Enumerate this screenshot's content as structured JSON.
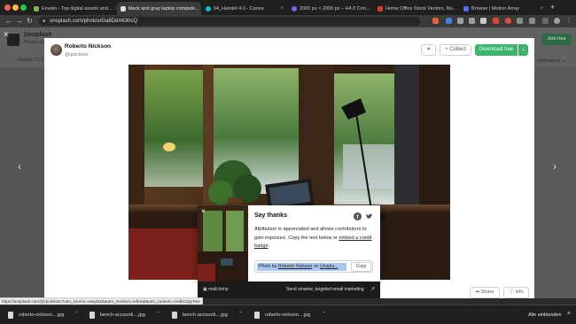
{
  "browser": {
    "tabs": [
      {
        "title": "Envato - Top digital assets and...",
        "active": false,
        "icon_color": "#82b541"
      },
      {
        "title": "black and gray laptop compute...",
        "active": true,
        "icon_color": "#dddddd"
      },
      {
        "title": "04_Handel 4.0 - Canva",
        "active": false,
        "icon_color": "#00c4cc"
      },
      {
        "title": "2000 px × 2000 px – H4.0 Con...",
        "active": false,
        "icon_color": "#7b61ff"
      },
      {
        "title": "Home Office Stock Vectors, Illu...",
        "active": false,
        "icon_color": "#e03a2f"
      },
      {
        "title": "Browse | Motion Array",
        "active": false,
        "icon_color": "#4a6cf7"
      }
    ],
    "tab_close_icon": "×",
    "new_tab_icon": "+",
    "back_icon": "←",
    "forward_icon": "→",
    "reload_icon": "↻",
    "url": "unsplash.com/photos/Ga8DdA630cQ"
  },
  "background": {
    "site_title": "Unsplash",
    "site_sub": "Photos fo",
    "photos_tab": "Photos 72.5",
    "relevance": "Relevance ⌄",
    "join_button": "Join free"
  },
  "modal": {
    "close_icon": "×",
    "prev_icon": "‹",
    "next_icon": "›",
    "author_name": "Roberto Nickson",
    "author_handle": "@rpnickson",
    "like_icon": "♥",
    "collect_label": "+ Collect",
    "download_label": "Download free",
    "download_menu_icon": "⌄",
    "share_label": "➦ Share",
    "info_label": "ⓘ Info"
  },
  "say_thanks": {
    "close_icon": "×",
    "title": "Say thanks",
    "body": "Attribution is appreciated and allows contributors to gain exposure. Copy the text below or",
    "link": "embed a credit badge",
    "link_end": ".",
    "credit_prefix": "Photo by ",
    "credit_author": "Roberto Nickson",
    "credit_mid": " on ",
    "credit_site": "Unspla...",
    "copy_label": "Copy"
  },
  "ad": {
    "logo": "▣ mailchimp",
    "text": "Send smarter, targeted email marketing",
    "icon": "↗"
  },
  "status_url": "https://unsplash.com/@rpnickson?utm_source=unsplash&utm_medium=referral&utm_content=creditCopyText",
  "downloads": {
    "items": [
      "roberto-nickson....jpg",
      "bench-accounti....jpg",
      "bench-accounti....jpg",
      "roberto-nickson....jpg"
    ],
    "chevron": "⌃",
    "show_all": "Alle einblenden",
    "close_icon": "×"
  },
  "colors": {
    "accent_green": "#3cb46e",
    "selection_blue": "#a9c7ee"
  }
}
